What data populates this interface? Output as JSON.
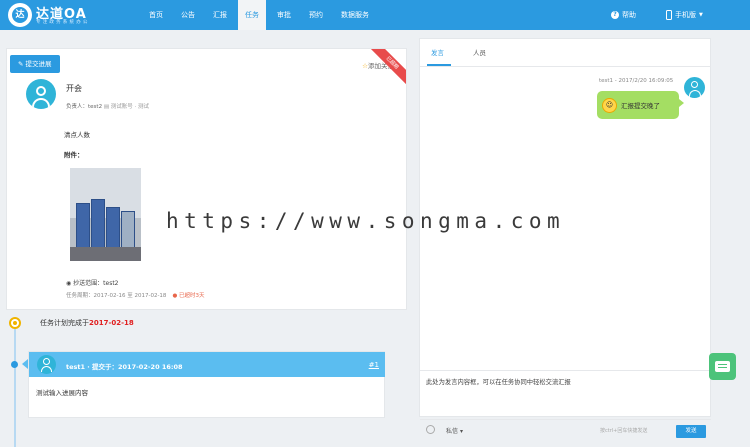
{
  "header": {
    "brand": "达道OA",
    "slogan": "专注政务系统办公",
    "nav": [
      {
        "label": "首页"
      },
      {
        "label": "公告"
      },
      {
        "label": "汇报"
      },
      {
        "label": "任务",
        "active": true
      },
      {
        "label": "审批"
      },
      {
        "label": "预约"
      },
      {
        "label": "数据服务"
      }
    ],
    "help": "帮助",
    "mobile": "手机版"
  },
  "task": {
    "submit_button": "提交进展",
    "follow": "添加关注",
    "ribbon": "已超期",
    "title": "开会",
    "owner_label": "负责人：test2",
    "project": "测试账号 · 测试",
    "content": "清点人数",
    "attachment_label": "附件：",
    "cc": "抄送范围：test2",
    "period": "任务周期：2017-02-16 至 2017-02-18",
    "overdue": "已超时3天"
  },
  "timeline": {
    "plan_prefix": "任务计划完成于",
    "plan_date": "2017-02-18",
    "progress": {
      "author": "test1 · 提交于：2017-02-20 16:08",
      "number": "#1",
      "body": "测试输入进展内容"
    }
  },
  "chat": {
    "tabs": [
      "发言",
      "人员"
    ],
    "message": {
      "meta": "test1 - 2017/2/20 16:09:05",
      "text": "汇报提交晚了"
    },
    "input_text": "此处为发言内容框，可以在任务协同中轻松交流汇报",
    "privacy": "私信",
    "hint": "按ctrl+回车快捷发送",
    "send": "发送"
  },
  "watermark": "https://www.songma.com",
  "colors": {
    "primary": "#2b9ae0",
    "overdue": "#e84b4b",
    "bubble": "#a4de63",
    "float_chat": "#4cc37a"
  }
}
